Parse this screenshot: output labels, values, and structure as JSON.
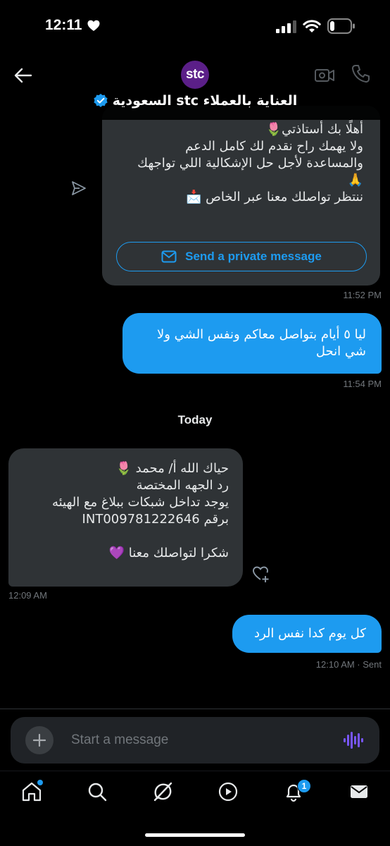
{
  "status_bar": {
    "time": "12:11"
  },
  "header": {
    "avatar_text": "stc",
    "contact_name": "العناية بالعملاء stc السعودية"
  },
  "messages": [
    {
      "direction": "incoming",
      "text": "أهلًا بك أستاذتي🌷\nولا يهمك راح نقدم لك كامل الدعم\nوالمساعدة لأجل حل الإشكالية اللي تواجهك\n🙏\nننتظر تواصلك معنا عبر الخاص 📩",
      "button_label": "Send a private message",
      "time": "11:52 PM"
    },
    {
      "direction": "outgoing",
      "text": "ليا ٥ أيام بتواصل معاكم ونفس الشي ولا شي انحل",
      "time": "11:54 PM"
    },
    {
      "direction": "incoming",
      "text": "حياك الله أ/   محمد   🌷\nرد الجهه المختصة\nيوجد تداخل شبكات ببلاغ مع الهيئه\nبرقم  INT009781222646\n\nشكرا لتواصلك معنا 💜",
      "time": "12:09 AM"
    },
    {
      "direction": "outgoing",
      "text": "كل يوم كدا نفس الرد",
      "time": "12:10 AM · Sent"
    }
  ],
  "day_separator": "Today",
  "composer": {
    "placeholder": "Start a message"
  },
  "bottom_nav": {
    "notifications_badge": "1"
  },
  "colors": {
    "accent": "#1d9bf0",
    "bubble_incoming": "#2f3336",
    "background": "#000000",
    "avatar": "#5b1f88"
  }
}
